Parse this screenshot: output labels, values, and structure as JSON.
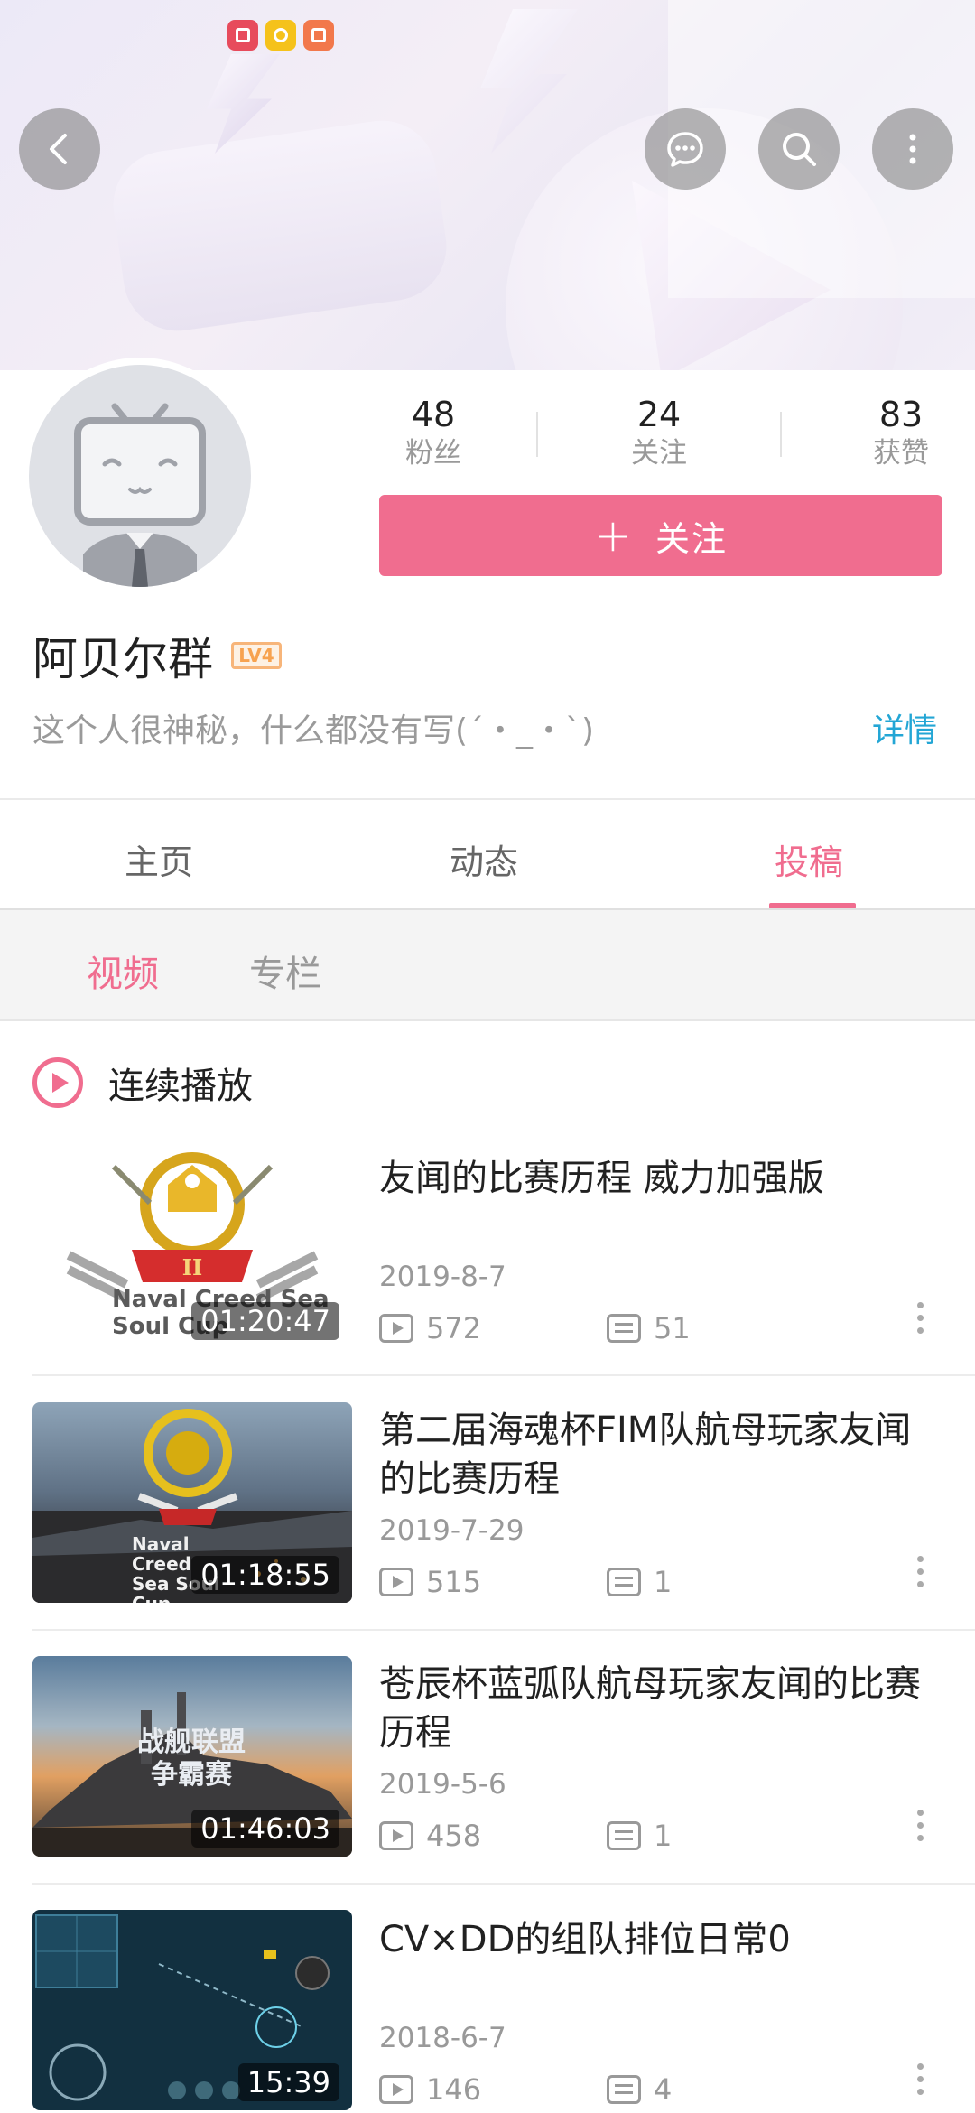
{
  "header": {
    "back_icon": "back-arrow-icon",
    "actions": [
      "message-icon",
      "search-icon",
      "more-vertical-icon"
    ],
    "status_icons": [
      "book-icon",
      "circle-icon",
      "heart-icon"
    ]
  },
  "profile": {
    "stats": [
      {
        "value": "48",
        "label": "粉丝"
      },
      {
        "value": "24",
        "label": "关注"
      },
      {
        "value": "83",
        "label": "获赞"
      }
    ],
    "follow_label": "关注",
    "name": "阿贝尔群",
    "level": "LV4",
    "bio": "这个人很神秘，什么都没有写(´・_・`)",
    "details_label": "详情"
  },
  "tabs": [
    {
      "label": "主页",
      "active": false
    },
    {
      "label": "动态",
      "active": false
    },
    {
      "label": "投稿",
      "active": true
    }
  ],
  "subtabs": [
    {
      "label": "视频",
      "active": true
    },
    {
      "label": "专栏",
      "active": false
    }
  ],
  "autoplay_label": "连续播放",
  "videos": [
    {
      "title": "友闻的比赛历程 威力加强版",
      "duration": "01:20:47",
      "date": "2019-8-7",
      "views": "572",
      "comments": "51",
      "thumb_text": "Naval Creed Sea Soul Cup"
    },
    {
      "title": "第二届海魂杯FIM队航母玩家友闻的比赛历程",
      "duration": "01:18:55",
      "date": "2019-7-29",
      "views": "515",
      "comments": "1",
      "thumb_text": "Naval Creed Sea Soul Cup"
    },
    {
      "title": "苍辰杯蓝弧队航母玩家友闻的比赛历程",
      "duration": "01:46:03",
      "date": "2019-5-6",
      "views": "458",
      "comments": "1",
      "thumb_text": "战舰联盟 争霸赛"
    },
    {
      "title": "CV×DD的组队排位日常0",
      "duration": "15:39",
      "date": "2018-6-7",
      "views": "146",
      "comments": "4",
      "thumb_text": ""
    }
  ],
  "colors": {
    "accent": "#f06d8f",
    "link": "#23a6d5",
    "muted": "#999999"
  }
}
